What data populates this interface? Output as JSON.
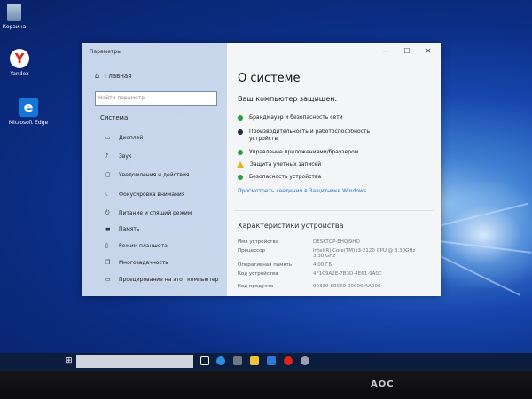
{
  "desktop": {
    "icons": [
      {
        "label": "Корзина",
        "icon": "recycle-bin-icon"
      },
      {
        "label": "Yandex",
        "icon": "yandex-browser-icon"
      },
      {
        "label": "Microsoft Edge",
        "icon": "edge-browser-icon"
      }
    ]
  },
  "window": {
    "title": "Параметры",
    "controls": {
      "minimize": "—",
      "maximize": "☐",
      "close": "✕"
    }
  },
  "sidebar": {
    "home": "Главная",
    "search_placeholder": "Найти параметр",
    "section": "Система",
    "items": [
      {
        "label": "Дисплей",
        "icon": "display-icon"
      },
      {
        "label": "Звук",
        "icon": "sound-icon"
      },
      {
        "label": "Уведомления и действия",
        "icon": "notifications-icon"
      },
      {
        "label": "Фокусировка внимания",
        "icon": "focus-assist-icon"
      },
      {
        "label": "Питание и спящий режим",
        "icon": "power-icon"
      },
      {
        "label": "Память",
        "icon": "storage-icon"
      },
      {
        "label": "Режим планшета",
        "icon": "tablet-mode-icon"
      },
      {
        "label": "Многозадачность",
        "icon": "multitasking-icon"
      },
      {
        "label": "Проецирование на этот компьютер",
        "icon": "projecting-icon"
      }
    ]
  },
  "main": {
    "title": "О системе",
    "subtitle": "Ваш компьютер защищен.",
    "status_items": [
      {
        "label": "Брандмауэр и безопасность сети",
        "status": "ok",
        "color": "#2a9d3c"
      },
      {
        "label": "Производительность и работоспособность устройств",
        "status": "info",
        "color": "#2b2540"
      },
      {
        "label": "Управление приложениями/браузером",
        "status": "ok",
        "color": "#2a9d3c"
      },
      {
        "label": "Защита учетных записей",
        "status": "warning",
        "color": "#e4b21b"
      },
      {
        "label": "Безопасность устройства",
        "status": "ok",
        "color": "#2a9d3c"
      }
    ],
    "details_link": "Просмотреть сведения в Защитнике Windows",
    "device_section": {
      "title": "Характеристики устройства",
      "rows": [
        {
          "key": "Имя устройства",
          "value": "DESKTOP-EHQJ9HO"
        },
        {
          "key": "Процессор",
          "value": "Intel(R) Core(TM) i3-2120 CPU @ 3.30GHz   3.30 GHz"
        },
        {
          "key": "Оперативная память",
          "value": "4,00 ГБ"
        },
        {
          "key": "Код устройства",
          "value": "4F1C9A2E-7B3D-4E61-9A0C"
        },
        {
          "key": "Код продукта",
          "value": "00330-80000-00000-AA000"
        }
      ]
    }
  },
  "taskbar": {
    "start_glyph": "⊞",
    "apps": [
      {
        "icon": "task-view-icon",
        "color": "#ffffff"
      },
      {
        "icon": "edge-icon",
        "color": "#2b8ce6"
      },
      {
        "icon": "explorer-icon",
        "color": "#6f7885"
      },
      {
        "icon": "store-icon",
        "color": "#f0c13b"
      },
      {
        "icon": "mail-icon",
        "color": "#2d7ad6"
      },
      {
        "icon": "yandex-icon",
        "color": "#e0251b"
      },
      {
        "icon": "settings-icon",
        "color": "#9aa3ad"
      }
    ]
  },
  "monitor": {
    "brand": "AOC"
  }
}
